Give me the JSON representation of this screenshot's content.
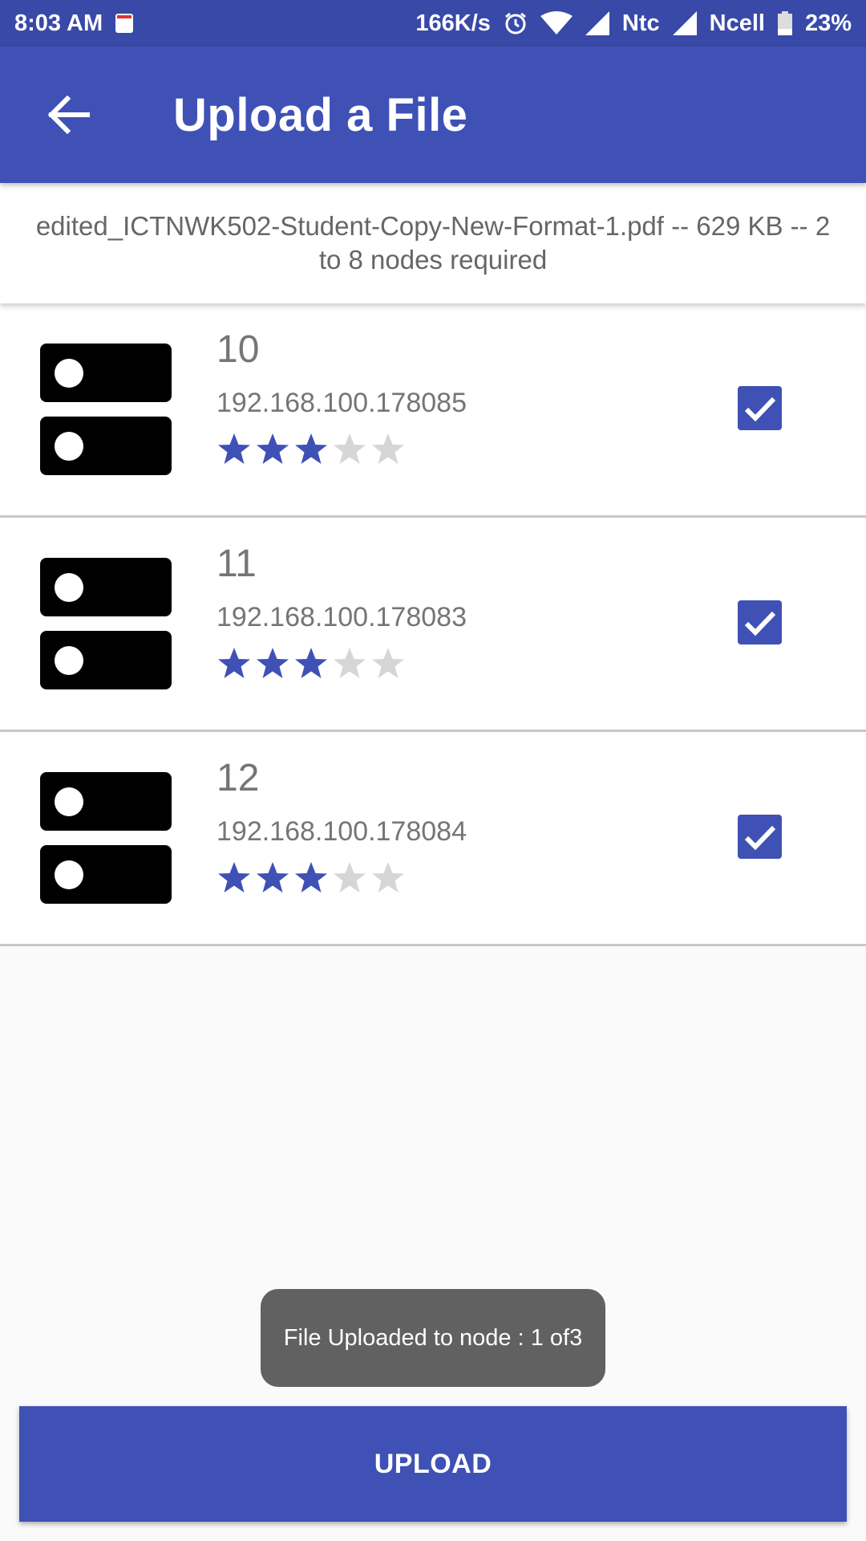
{
  "status_bar": {
    "time": "8:03 AM",
    "speed": "166K/s",
    "carrier1": "Ntc",
    "carrier2": "Ncell",
    "battery": "23%",
    "icons": [
      "calendar-icon",
      "alarm-icon",
      "wifi-icon",
      "signal-icon",
      "battery-icon"
    ]
  },
  "app_bar": {
    "title": "Upload a File",
    "back_icon": "arrow-back-icon"
  },
  "file_info": {
    "text": "edited_ICTNWK502-Student-Copy-New-Format-1.pdf  --  629 KB  --  2 to 8 nodes required"
  },
  "nodes": [
    {
      "name": "10",
      "ip": "192.168.100.178085",
      "rating": 3,
      "rating_max": 5,
      "checked": true
    },
    {
      "name": "11",
      "ip": "192.168.100.178083",
      "rating": 3,
      "rating_max": 5,
      "checked": true
    },
    {
      "name": "12",
      "ip": "192.168.100.178084",
      "rating": 3,
      "rating_max": 5,
      "checked": true
    }
  ],
  "toast": {
    "text": "File Uploaded to node : 1 of3"
  },
  "upload_button": {
    "label": "UPLOAD"
  },
  "colors": {
    "primary": "#3f51b5",
    "primary_dark": "#3949a8",
    "star_filled": "#3f51b5",
    "star_empty": "#d6d6d6",
    "toast_bg": "#616161"
  }
}
